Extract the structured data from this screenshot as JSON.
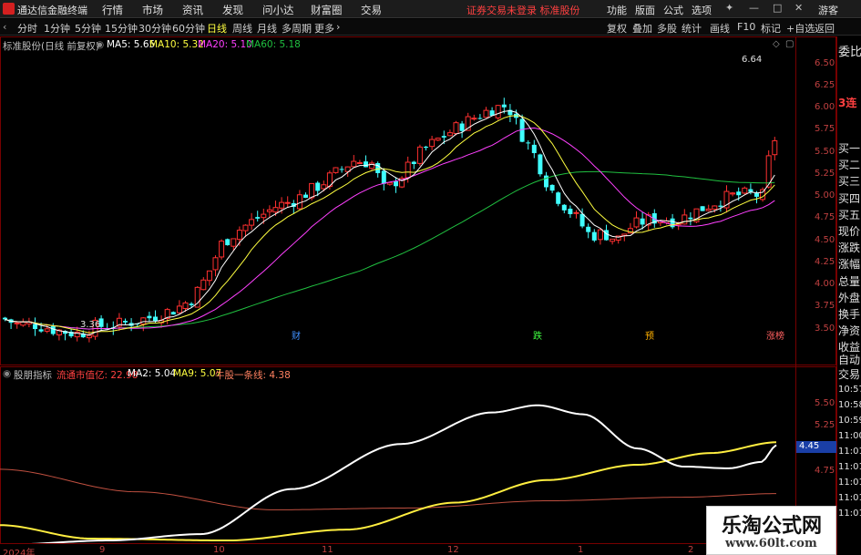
{
  "titlebar": {
    "app_name": "通达信金融终端",
    "menus": [
      "行情",
      "市场",
      "资讯",
      "发现",
      "问小达",
      "财富圈",
      "交易"
    ],
    "warning": "证券交易未登录  标准股份",
    "right_menus": [
      "功能",
      "版面",
      "公式",
      "选项"
    ],
    "guest": "游客"
  },
  "toolbar": {
    "periods": [
      "分时",
      "1分钟",
      "5分钟",
      "15分钟",
      "30分钟",
      "60分钟",
      "日线",
      "周线",
      "月线",
      "多周期",
      "更多"
    ],
    "active_period": "日线",
    "right_buttons": [
      "复权",
      "叠加",
      "多股",
      "统计",
      "画线",
      "F10",
      "标记",
      "+自选",
      "返回"
    ]
  },
  "main_legend": {
    "title": "标准股份(日线 前复权)",
    "ma5": "MA5: 5.65",
    "ma10": "MA10: 5.32",
    "ma20": "MA20: 5.10",
    "ma60": "MA60: 5.18"
  },
  "indicator_legend": {
    "title": "股朋指标",
    "v1": "流通市值亿: 22.98",
    "v2": "MA2: 5.04",
    "v3": "MA9: 5.07",
    "v4": "牛股一条线: 4.38"
  },
  "price_axis": [
    "6.50",
    "6.25",
    "6.00",
    "5.75",
    "5.50",
    "5.25",
    "5.00",
    "4.75",
    "4.50",
    "4.25",
    "4.00",
    "3.75",
    "3.50"
  ],
  "indicator_axis": [
    "5.50",
    "5.25",
    "5.00",
    "4.75",
    "4.25",
    "4.00"
  ],
  "current_indicator_value": "4.45",
  "annotations": {
    "high": "6.64",
    "low": "3.36"
  },
  "events": [
    {
      "text": "财",
      "color": "#4090ff"
    },
    {
      "text": "跌",
      "color": "#40ff40"
    },
    {
      "text": "预",
      "color": "#ffb000"
    },
    {
      "text": "涨榜",
      "color": "#ff6060"
    }
  ],
  "date_axis": [
    "2024年",
    "9",
    "10",
    "11",
    "12",
    "1",
    "2"
  ],
  "right_panel": {
    "title": "委比",
    "streak": "3连",
    "items": [
      "买一",
      "买二",
      "买三",
      "买四",
      "买五",
      "现价",
      "涨跌",
      "涨幅",
      "总量",
      "外盘",
      "换手",
      "净资",
      "收益"
    ],
    "auto_trade": [
      "自动",
      "交易"
    ],
    "times": [
      "10:57",
      "10:58",
      "10:59",
      "11:00",
      "11:01",
      "11:01",
      "11:01",
      "11:01",
      "11:01"
    ]
  },
  "watermark": {
    "title": "乐淘公式网",
    "url": "www.60lt.com"
  },
  "colors": {
    "up": "#ff3030",
    "down": "#40ffff",
    "ma5": "#ffffff",
    "ma10": "#ffff40",
    "ma20": "#ff40ff",
    "ma60": "#20c040",
    "frame": "#770000"
  }
}
